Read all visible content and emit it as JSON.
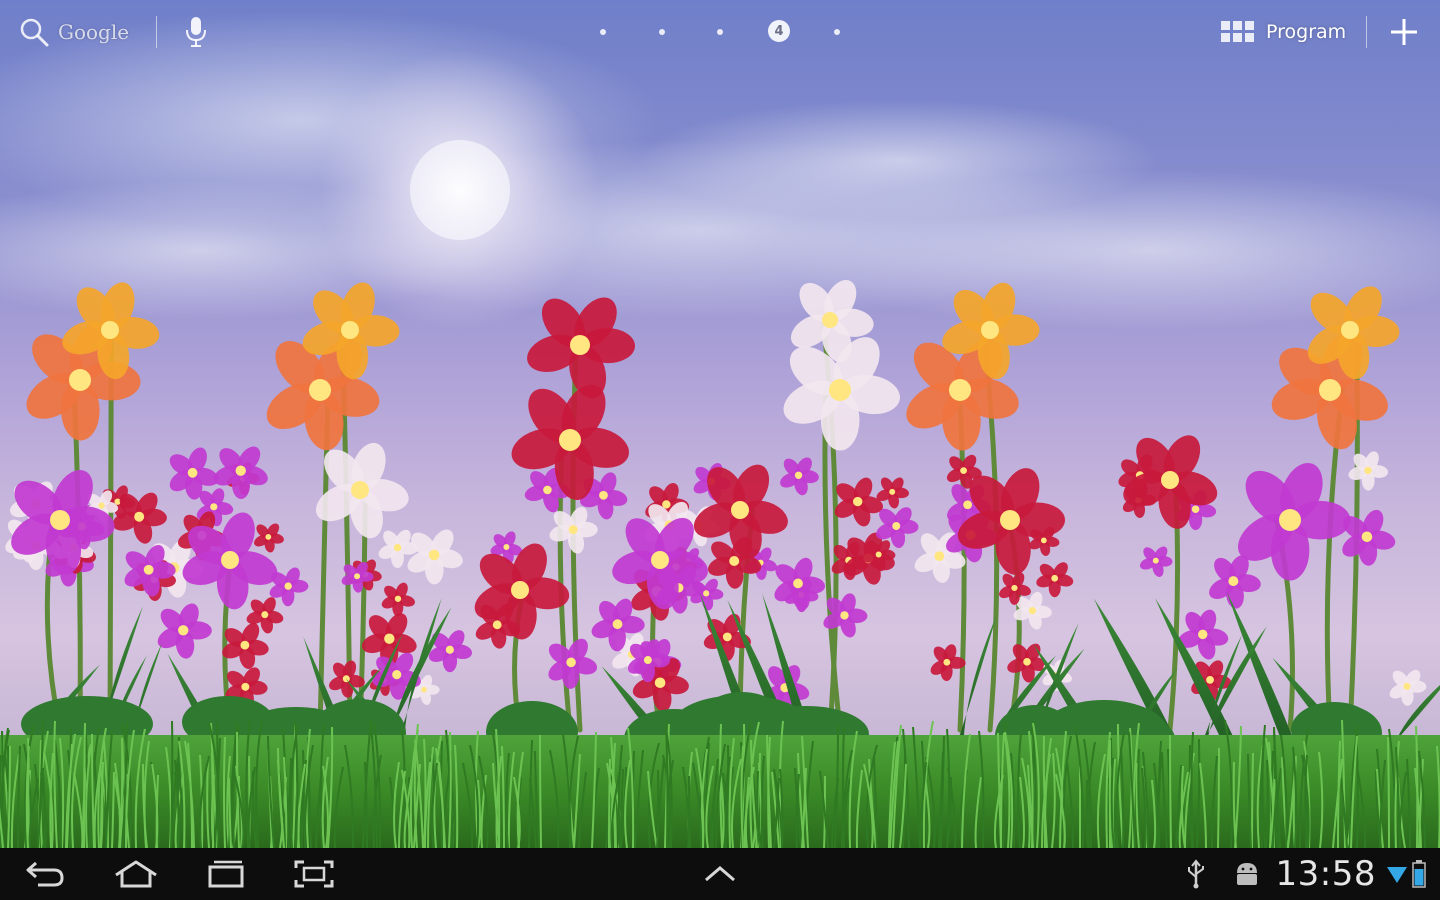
{
  "top_bar": {
    "search_label": "Google",
    "current_page": "4",
    "apps_label": "Program"
  },
  "system_bar": {
    "clock": "13:58"
  },
  "icons": {
    "search": "search-icon",
    "voice": "microphone-icon",
    "apps": "apps-grid-icon",
    "add": "plus-icon",
    "back": "back-icon",
    "home": "home-icon",
    "recents": "recent-apps-icon",
    "screenshot": "screenshot-icon",
    "menu": "chevron-up-icon",
    "usb": "usb-icon",
    "android": "android-icon",
    "wifi": "wifi-icon",
    "battery": "battery-icon"
  },
  "colors": {
    "sky_top": "#6f7fc9",
    "sky_bottom": "#d6c4e0",
    "grass": "#3f8f2a",
    "system_bar": "#0d0d0d",
    "orchid_orange": "#f0743e",
    "orchid_magenta": "#c13ad0",
    "orchid_red": "#c8193c",
    "orchid_white": "#f2e6ef",
    "orchid_yellow": "#f4a52a"
  }
}
